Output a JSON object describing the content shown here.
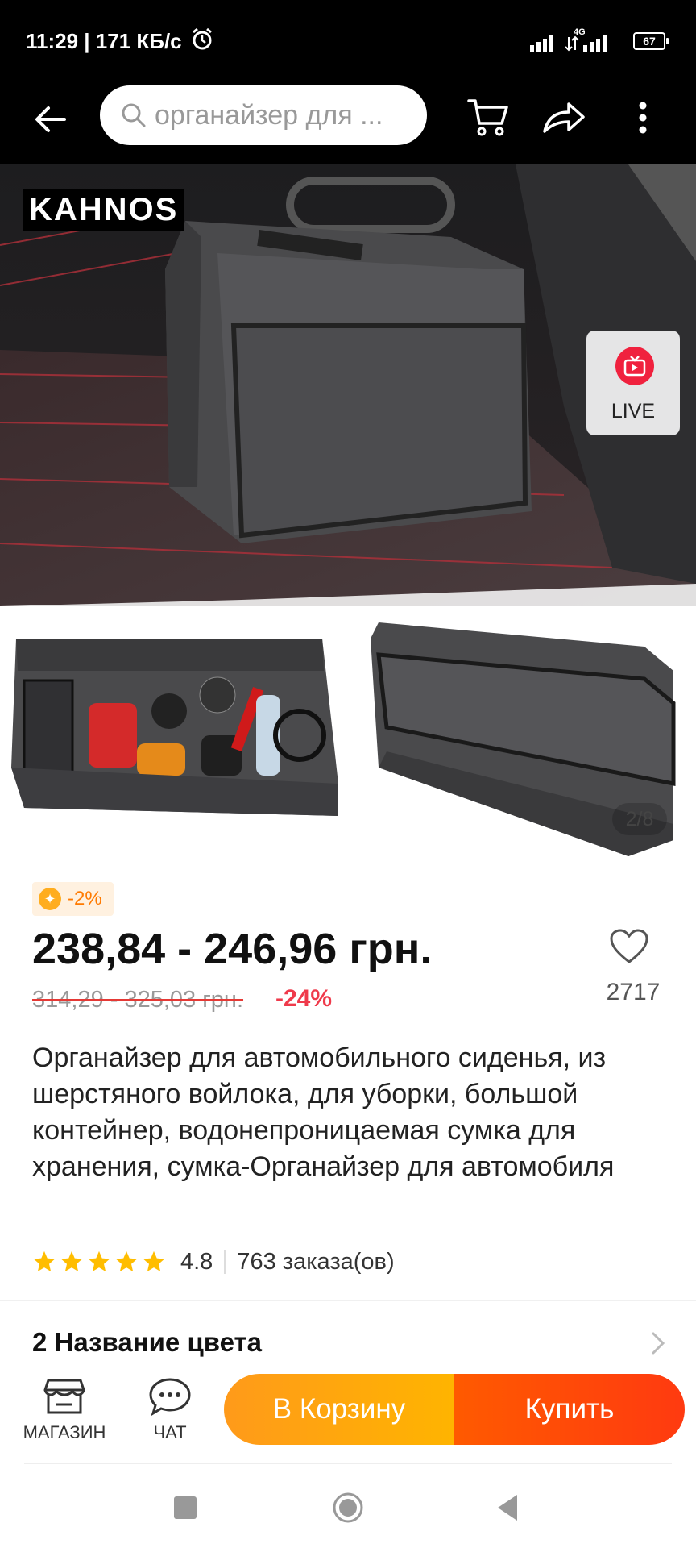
{
  "status_bar": {
    "time_speed": "11:29 | 171 КБ/с",
    "network": "4G",
    "battery": "67"
  },
  "header": {
    "search_text": "органайзер для ..."
  },
  "hero": {
    "brand": "KAHNOS",
    "live_label": "LIVE",
    "image_counter": "2/8"
  },
  "product": {
    "badge": "-2%",
    "price": "238,84 - 246,96 грн.",
    "old_price": "314,29 - 325,03 грн.",
    "discount": "-24%",
    "favorites_count": "2717",
    "title": "Органайзер для автомобильного сиденья, из шерстяного войлока, для уборки, большой контейнер, водонепроницаемая сумка для хранения, сумка-Органайзер для автомобиля",
    "rating": "4.8",
    "rating_stars": 5,
    "orders": "763 заказа(ов)",
    "color_section": "2 Название цвета"
  },
  "bottom_bar": {
    "shop_label": "МАГАЗИН",
    "chat_label": "ЧАТ",
    "cart_button": "В Корзину",
    "buy_button": "Купить"
  },
  "colors": {
    "accent_orange": "#ff9a1a",
    "accent_red": "#ff3a10",
    "discount_red": "#ef3a4b",
    "live_red": "#f0213e"
  }
}
